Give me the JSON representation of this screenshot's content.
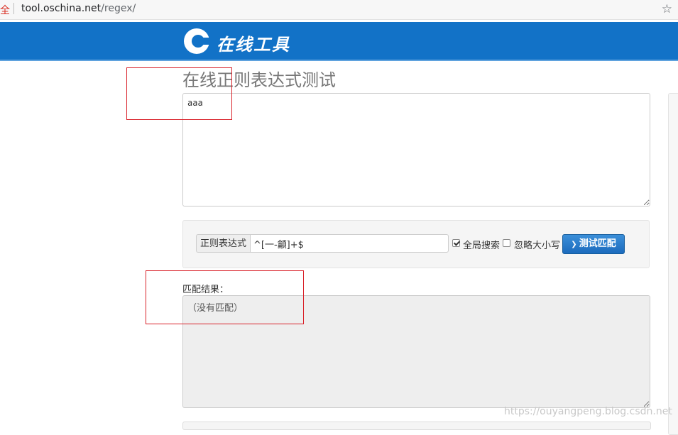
{
  "browser": {
    "secure_label": "全",
    "url_host": "tool.oschina.net",
    "url_path": "/regex/",
    "star_glyph": "☆"
  },
  "header": {
    "logo_text": "在线工具",
    "bg_color": "#1272c7"
  },
  "page": {
    "title": "在线正则表达式测试"
  },
  "source": {
    "text": "aaa"
  },
  "regex_form": {
    "addon_label": "正则表达式",
    "regex_value": "^[一-龥]+$",
    "global_label": "全局搜索",
    "global_checked": true,
    "ignore_case_label": "忽略大小写",
    "ignore_case_checked": false,
    "test_button_label": "测试匹配",
    "button_color": "#1c6bbd"
  },
  "result": {
    "label": "匹配结果：",
    "text": "（没有匹配）"
  },
  "watermark": "https://ouyangpeng.blog.csdn.net"
}
